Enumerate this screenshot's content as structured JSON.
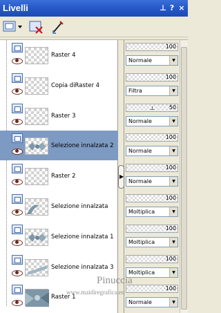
{
  "window": {
    "title": "Livelli"
  },
  "titlebar_icons": [
    "pin-icon",
    "help-icon",
    "close-icon"
  ],
  "toolbar": {
    "buttons": [
      "new-layer-icon",
      "delete-layer-icon",
      "edit-icon"
    ]
  },
  "layers": [
    {
      "name": "Raster 4",
      "opacity": 100,
      "blend": "Normale",
      "selected": false,
      "thumb": "empty"
    },
    {
      "name": "Copia diRaster 4",
      "opacity": 100,
      "blend": "Filtra",
      "selected": false,
      "thumb": "empty"
    },
    {
      "name": "Raster 3",
      "opacity": 50,
      "blend": "Normale",
      "selected": false,
      "thumb": "empty"
    },
    {
      "name": "Selezione innalzata 2",
      "opacity": 100,
      "blend": "Normale",
      "selected": true,
      "thumb": "shapes"
    },
    {
      "name": "Raster 2",
      "opacity": 100,
      "blend": "Normale",
      "selected": false,
      "thumb": "empty"
    },
    {
      "name": "Selezione innalzata",
      "opacity": 100,
      "blend": "Moltiplica",
      "selected": false,
      "thumb": "swirl"
    },
    {
      "name": "Selezione innalzata 1",
      "opacity": 100,
      "blend": "Moltiplica",
      "selected": false,
      "thumb": "shapes"
    },
    {
      "name": "Selezione innalzata 3",
      "opacity": 100,
      "blend": "Moltiplica",
      "selected": false,
      "thumb": "band"
    },
    {
      "name": "Raster 1",
      "opacity": 100,
      "blend": "Normale",
      "selected": false,
      "thumb": "texture"
    }
  ],
  "watermark": {
    "line1": "Pinuccia",
    "line2": "www.maidiregrafica.eu"
  },
  "colors": {
    "titlebar": "#2456c6",
    "selected_row": "#7d9ac3",
    "panel_bg": "#ece9d8"
  }
}
